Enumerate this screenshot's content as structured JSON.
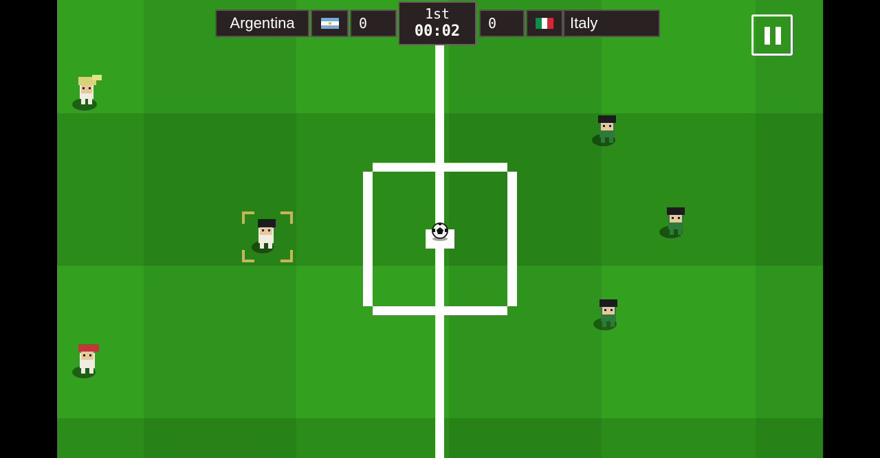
{
  "match": {
    "home_team": "Argentina",
    "home_score": "0",
    "away_team": "Italy",
    "away_score": "0",
    "period": "1st",
    "clock": "00:02"
  },
  "icons": {
    "home_flag": "argentina-flag-icon",
    "away_flag": "italy-flag-icon",
    "pause": "pause-icon",
    "ball": "soccer-ball-icon"
  },
  "colors": {
    "pitch_light": "#38a824",
    "pitch_dark": "#2a8a18",
    "scoreboard_bg": "#2a2222",
    "selection": "#c8b45a",
    "lines": "#ffffff"
  },
  "players": [
    {
      "team": "Argentina",
      "hair": "blonde"
    },
    {
      "team": "Argentina",
      "hair": "dark",
      "selected": true
    },
    {
      "team": "Argentina",
      "hair": "red"
    },
    {
      "team": "Italy",
      "hair": "dark"
    },
    {
      "team": "Italy",
      "hair": "dark"
    },
    {
      "team": "Italy",
      "hair": "dark"
    }
  ]
}
